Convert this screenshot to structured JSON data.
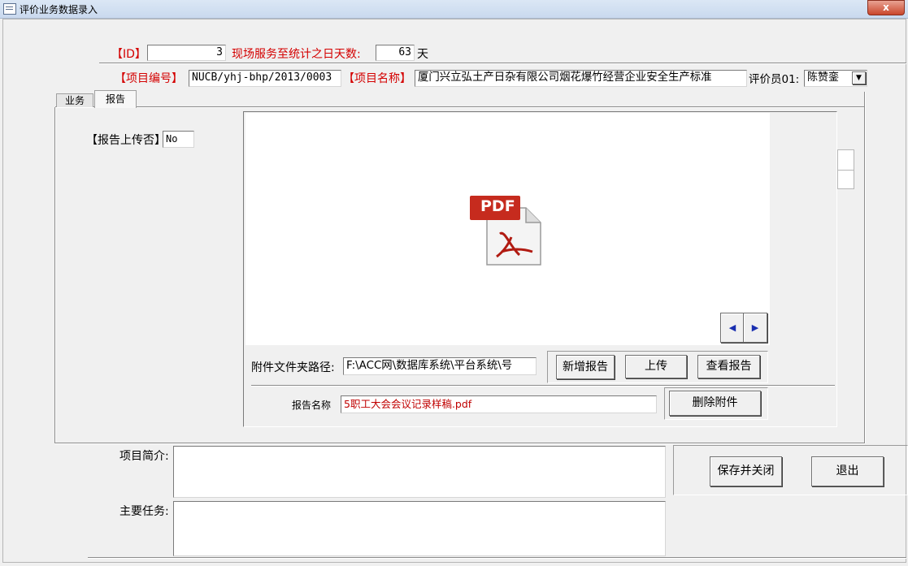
{
  "window": {
    "title": "评价业务数据录入",
    "close_label": "x"
  },
  "header": {
    "id_label": "【ID】",
    "id_value": "3",
    "days_label": "现场服务至统计之日天数:",
    "days_value": "63",
    "days_unit": "天",
    "project_code_label": "【项目编号】",
    "project_code_value": "NUCB/yhj-bhp/2013/0003",
    "project_name_label": "【项目名称】",
    "project_name_value": "厦门兴立弘土产日杂有限公司烟花爆竹经营企业安全生产标准",
    "evaluator_label": "评价员01:",
    "evaluator_value": "陈赞銮"
  },
  "tabs": [
    {
      "label": "业务"
    },
    {
      "label": "报告"
    }
  ],
  "report": {
    "uploaded_label": "【报告上传否】",
    "uploaded_value": "No",
    "pdf_icon_text": "PDF",
    "folder_label": "附件文件夹路径:",
    "folder_value": "F:\\ACC网\\数据库系统\\平台系统\\号",
    "new_report_btn": "新增报告",
    "upload_btn": "上传",
    "view_report_btn": "查看报告",
    "report_name_label": "报告名称",
    "report_name_value": "5职工大会会议记录样稿.pdf",
    "delete_attachment_btn": "删除附件"
  },
  "bottom": {
    "intro_label": "项目简介:",
    "intro_value": "",
    "tasks_label": "主要任务:",
    "tasks_value": "",
    "save_close_btn": "保存并关闭",
    "exit_btn": "退出"
  },
  "colors": {
    "label_red": "#d40000",
    "link_red": "#c00000",
    "nav_arrow": "#1a2fb0"
  }
}
